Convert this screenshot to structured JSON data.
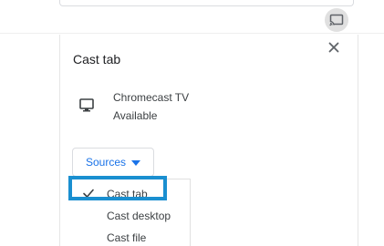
{
  "dialog": {
    "title": "Cast tab"
  },
  "sink": {
    "name": "Chromecast TV",
    "status": "Available",
    "icon": "monitor-icon"
  },
  "sources": {
    "label": "Sources",
    "menu": [
      {
        "label": "Cast tab",
        "checked": true
      },
      {
        "label": "Cast desktop",
        "checked": false
      },
      {
        "label": "Cast file",
        "checked": false
      }
    ]
  },
  "icons": {
    "toolbar": "cast-icon",
    "close": "close-icon",
    "check": "check-icon"
  },
  "colors": {
    "accent": "#1a73e8",
    "highlight": "#1a8fd0"
  }
}
